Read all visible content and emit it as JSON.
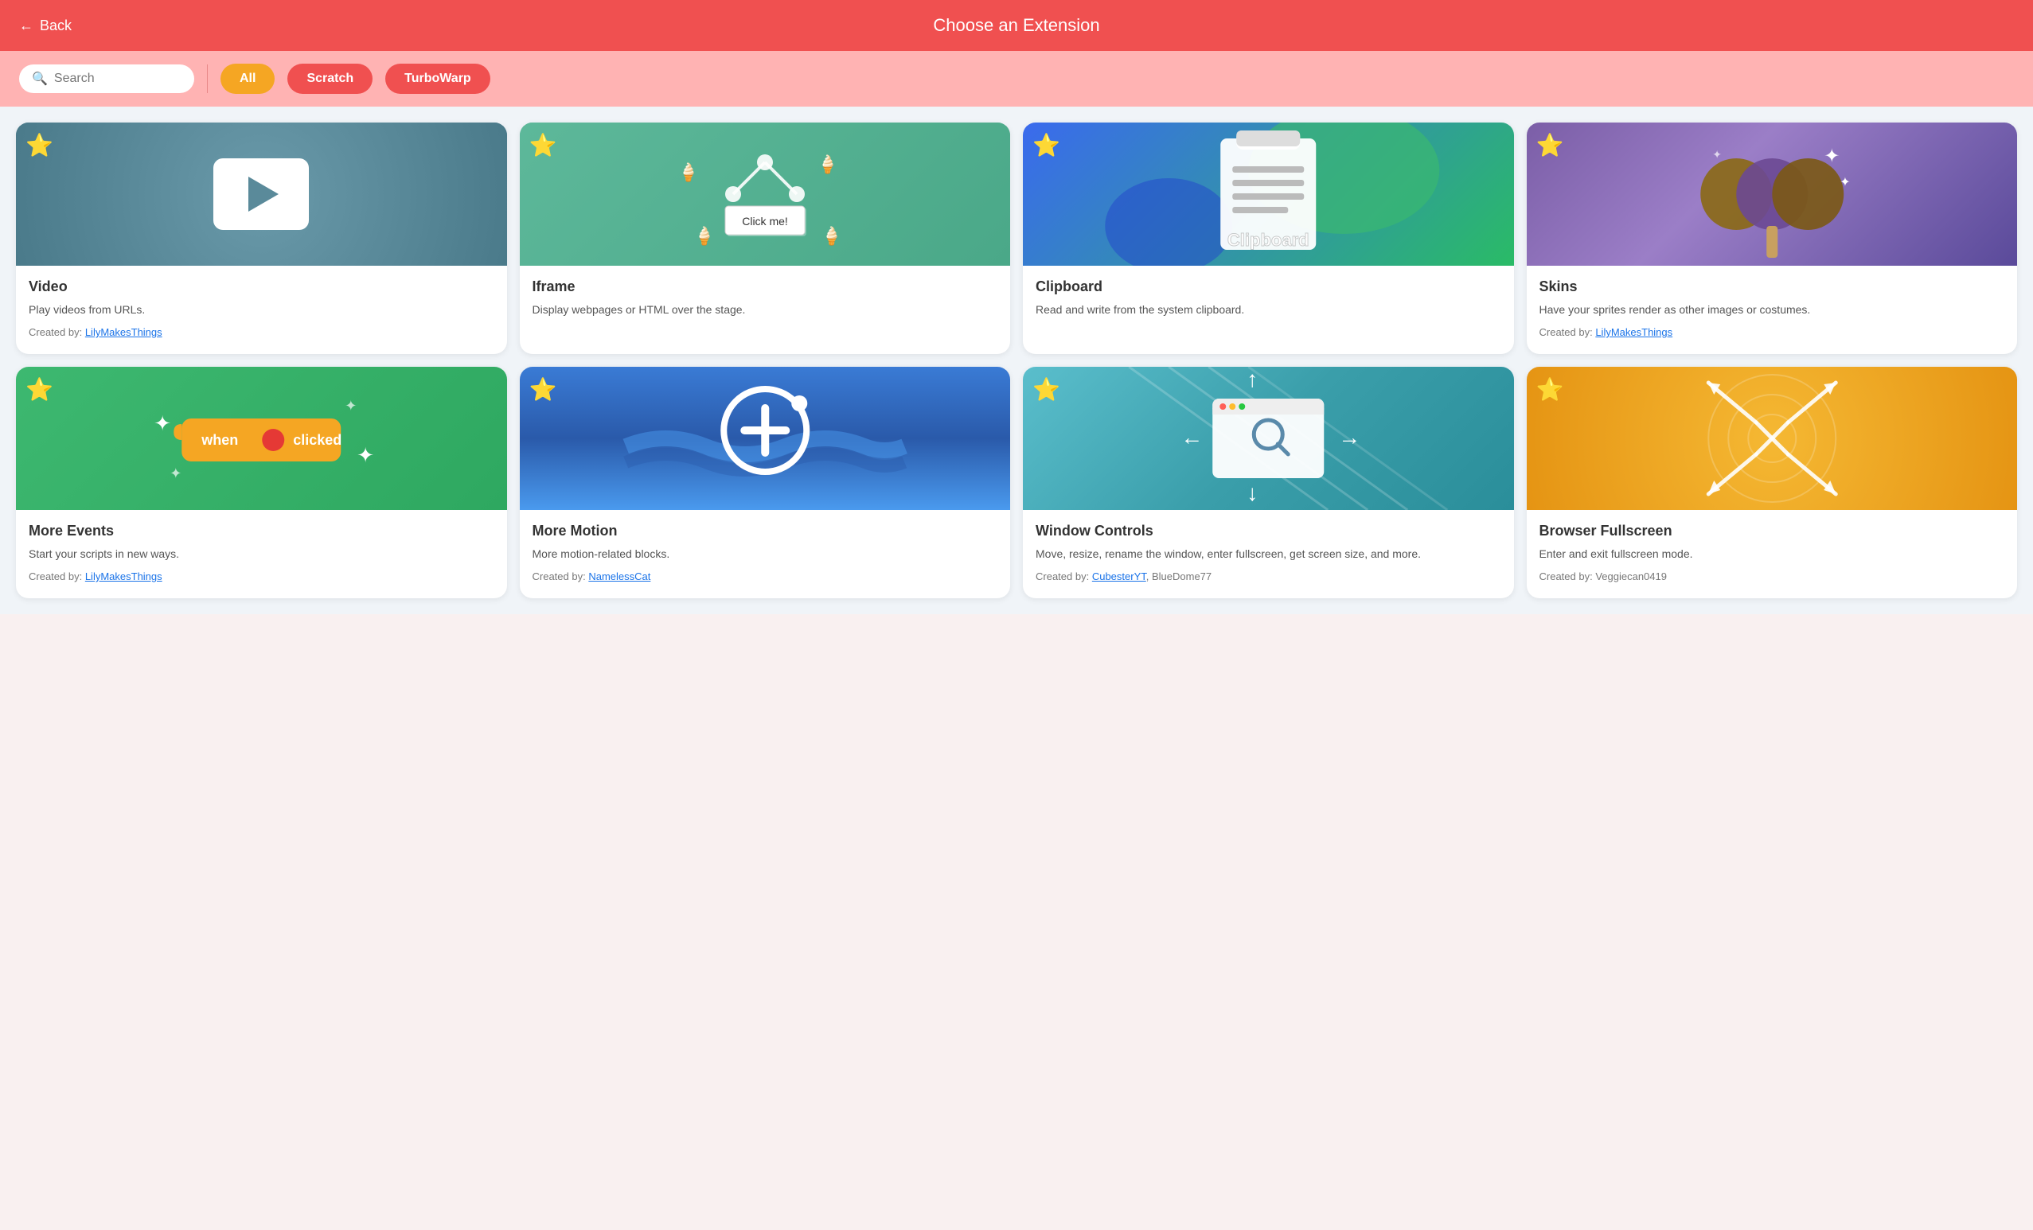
{
  "header": {
    "back_label": "Back",
    "title": "Choose an Extension"
  },
  "filter_bar": {
    "search_placeholder": "Search",
    "filters": [
      {
        "id": "all",
        "label": "All",
        "active": false,
        "color": "#f5a623"
      },
      {
        "id": "scratch",
        "label": "Scratch",
        "active": true,
        "color": "#f05050"
      },
      {
        "id": "turbowarp",
        "label": "TurboWarp",
        "active": true,
        "color": "#f05050"
      }
    ]
  },
  "extensions": [
    {
      "id": "video",
      "title": "Video",
      "description": "Play videos from URLs.",
      "author": "LilyMakesThings",
      "author_link": true,
      "has_star": true,
      "bg_color": "#5a8a9a"
    },
    {
      "id": "iframe",
      "title": "Iframe",
      "description": "Display webpages or HTML over the stage.",
      "author": null,
      "author_link": false,
      "has_star": true,
      "bg_color": "#5db89a"
    },
    {
      "id": "clipboard",
      "title": "Clipboard",
      "description": "Read and write from the system clipboard.",
      "author": null,
      "author_link": false,
      "has_star": true,
      "bg_color": "#4a8af0"
    },
    {
      "id": "skins",
      "title": "Skins",
      "description": "Have your sprites render as other images or costumes.",
      "author": "LilyMakesThings",
      "author_link": true,
      "has_star": true,
      "bg_color": "#7b5ea7"
    },
    {
      "id": "more-events",
      "title": "More Events",
      "description": "Start your scripts in new ways.",
      "author": "LilyMakesThings",
      "author_link": true,
      "has_star": true,
      "bg_color": "#3db870"
    },
    {
      "id": "more-motion",
      "title": "More Motion",
      "description": "More motion-related blocks.",
      "author": "NamelessCat",
      "author_link": true,
      "has_star": true,
      "bg_color": "#3a7bd5"
    },
    {
      "id": "window-controls",
      "title": "Window Controls",
      "description": "Move, resize, rename the window, enter fullscreen, get screen size, and more.",
      "author": "CubesterYT, BlueDome77",
      "author_link": true,
      "has_star": true,
      "bg_color": "#5abecc"
    },
    {
      "id": "browser-fullscreen",
      "title": "Browser Fullscreen",
      "description": "Enter and exit fullscreen mode.",
      "author": "Veggiecan0419",
      "author_link": false,
      "has_star": true,
      "bg_color": "#f5a623"
    }
  ],
  "labels": {
    "created_by": "Created by:"
  }
}
